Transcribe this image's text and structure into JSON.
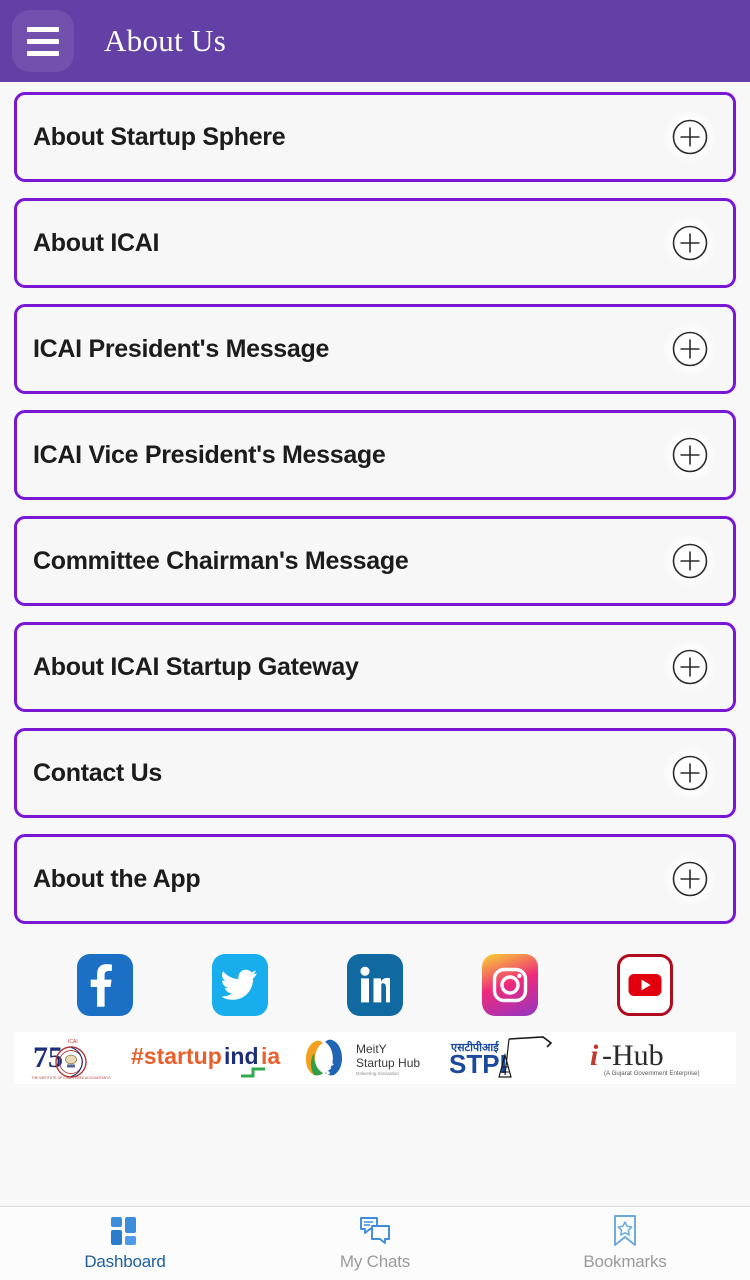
{
  "header": {
    "title": "About Us",
    "menu_icon": "hamburger-menu-icon",
    "background_color": "#6340a5"
  },
  "list": {
    "expand_icon": "plus-circle-icon",
    "border_color": "#7a17d4",
    "items": [
      {
        "label": "About Startup Sphere"
      },
      {
        "label": "About ICAI"
      },
      {
        "label": "ICAI President's Message"
      },
      {
        "label": "ICAI Vice President's Message"
      },
      {
        "label": "Committee Chairman's Message"
      },
      {
        "label": "About ICAI Startup Gateway"
      },
      {
        "label": "Contact Us"
      },
      {
        "label": "About the App"
      }
    ]
  },
  "social": {
    "items": [
      {
        "name": "facebook-icon",
        "label": "Facebook",
        "color": "#1b6fc4"
      },
      {
        "name": "twitter-icon",
        "label": "Twitter",
        "color": "#18aeee"
      },
      {
        "name": "linkedin-icon",
        "label": "LinkedIn",
        "color": "#1069a0"
      },
      {
        "name": "instagram-icon",
        "label": "Instagram",
        "color": "#ee2a7b"
      },
      {
        "name": "youtube-icon",
        "label": "YouTube",
        "color": "#b00b1e"
      }
    ]
  },
  "partners": {
    "items": [
      {
        "name": "icai-75-logo",
        "label": "ICAI 75"
      },
      {
        "name": "startup-india-logo",
        "label": "#startupindia"
      },
      {
        "name": "meity-startup-hub-logo",
        "label": "MeitY Startup Hub",
        "tagline": "Delivering Innovation"
      },
      {
        "name": "stpi-logo",
        "label": "STPI",
        "hindi": "एसटीपीआई"
      },
      {
        "name": "i-hub-logo",
        "label": "i-Hub",
        "subtitle": "(A Gujarat Government Enterprise)"
      }
    ]
  },
  "bottom_nav": {
    "items": [
      {
        "label": "Dashboard",
        "icon": "dashboard-grid-icon",
        "active": true
      },
      {
        "label": "My Chats",
        "icon": "chat-bubbles-icon",
        "active": false
      },
      {
        "label": "Bookmarks",
        "icon": "bookmark-star-icon",
        "active": false
      }
    ],
    "active_color": "#1d5f9e",
    "inactive_color": "#9a9a9a",
    "icon_color": "#3d8ddb"
  }
}
